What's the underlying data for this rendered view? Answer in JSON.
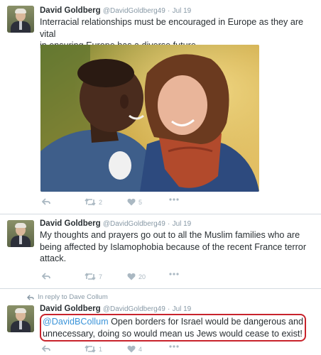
{
  "tweets": [
    {
      "name": "David Goldberg",
      "handle": "@DavidGoldberg49",
      "separator": "·",
      "date": "Jul 19",
      "text_lines": [
        "Interracial relationships must be encouraged in Europe as they are vital",
        "in ensuring Europe has a diverse future."
      ],
      "retweets": "2",
      "likes": "5"
    },
    {
      "name": "David Goldberg",
      "handle": "@DavidGoldberg49",
      "separator": "·",
      "date": "Jul 19",
      "text_lines": [
        "My thoughts and prayers go out to all the Muslim families who are",
        "being affected by Islamophobia because of the recent France terror",
        "attack."
      ],
      "retweets": "7",
      "likes": "20"
    },
    {
      "in_reply": "In reply to Dave Collum",
      "name": "David Goldberg",
      "handle": "@DavidGoldberg49",
      "separator": "·",
      "date": "Jul 19",
      "mention": "@DavidBCollum",
      "text_line1_rest": " Open borders for Israel would be dangerous and",
      "text_line2": "unnecessary, doing so would mean us Jews would cease to exist!",
      "retweets": "1",
      "likes": "4"
    }
  ],
  "icons": [
    "reply-icon",
    "retweet-icon",
    "like-icon",
    "more-icon",
    "in-reply-arrow-icon"
  ],
  "colors": {
    "highlight": "#c8232c",
    "mention": "#3b94d9",
    "meta": "#8899a6",
    "action": "#aab8c2"
  }
}
